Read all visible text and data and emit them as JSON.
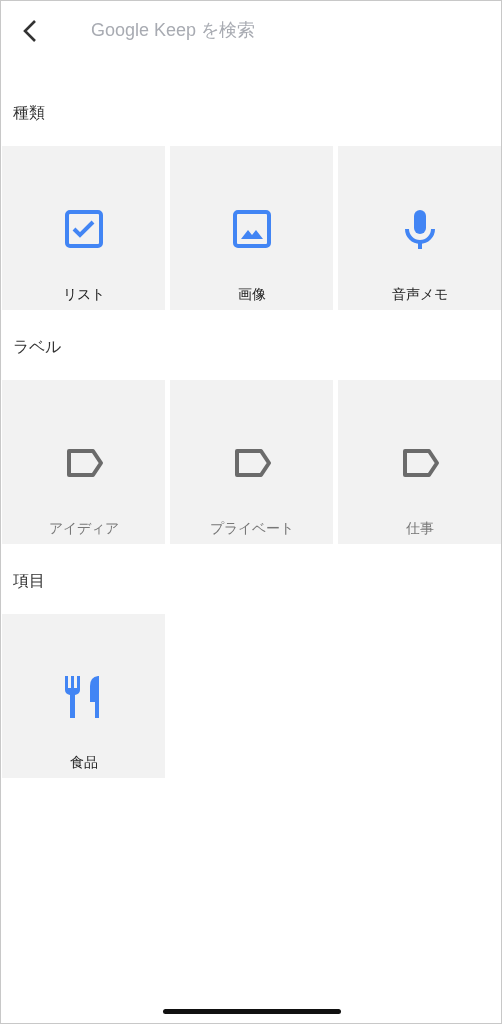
{
  "search": {
    "placeholder": "Google Keep を検索"
  },
  "sections": [
    {
      "title": "種類",
      "tiles": [
        {
          "kind": "list",
          "label": "リスト"
        },
        {
          "kind": "image",
          "label": "画像"
        },
        {
          "kind": "voice",
          "label": "音声メモ"
        }
      ]
    },
    {
      "title": "ラベル",
      "tiles": [
        {
          "kind": "label",
          "label": "アイディア"
        },
        {
          "kind": "label",
          "label": "プライベート"
        },
        {
          "kind": "label",
          "label": "仕事"
        }
      ]
    },
    {
      "title": "項目",
      "tiles": [
        {
          "kind": "food",
          "label": "食品"
        }
      ]
    }
  ]
}
